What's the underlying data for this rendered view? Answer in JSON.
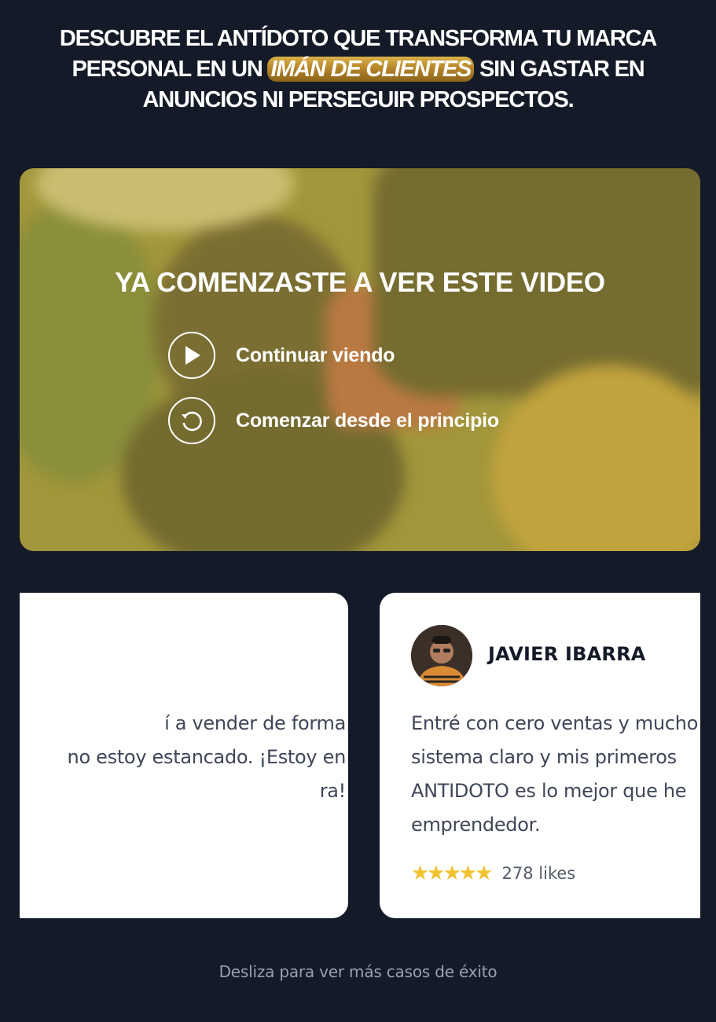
{
  "headline": {
    "part1": "DESCUBRE ",
    "part2_bold": "EL ANTÍDOTO QUE TRANSFORMA TU MARCA PERSONAL",
    "part3": " EN UN ",
    "highlight": "IMÁN DE CLIENTES",
    "part4": " SIN GASTAR EN ANUNCIOS NI PERSEGUIR PROSPECTOS."
  },
  "video": {
    "title": "YA COMENZASTE A VER ESTE VIDEO",
    "continue_label": "Continuar viendo",
    "restart_label": "Comenzar desde el principio",
    "continue_icon": "play-icon",
    "restart_icon": "restart-icon"
  },
  "testimonials": [
    {
      "lines": [
        "í a vender de forma",
        "no estoy estancado. ¡Estoy en",
        "ra!"
      ]
    },
    {
      "author": "JAVIER IBARRA",
      "lines": [
        "Entré con cero ventas y mucho",
        "sistema claro y mis primeros",
        "ANTIDOTO es lo mejor que he",
        "emprendedor."
      ],
      "stars": "★★★★★",
      "likes": "278 likes"
    }
  ],
  "swipe_hint": "Desliza para ver más casos de éxito",
  "colors": {
    "background": "#141a27",
    "gold": "#c89a36",
    "star": "#f2c230"
  }
}
